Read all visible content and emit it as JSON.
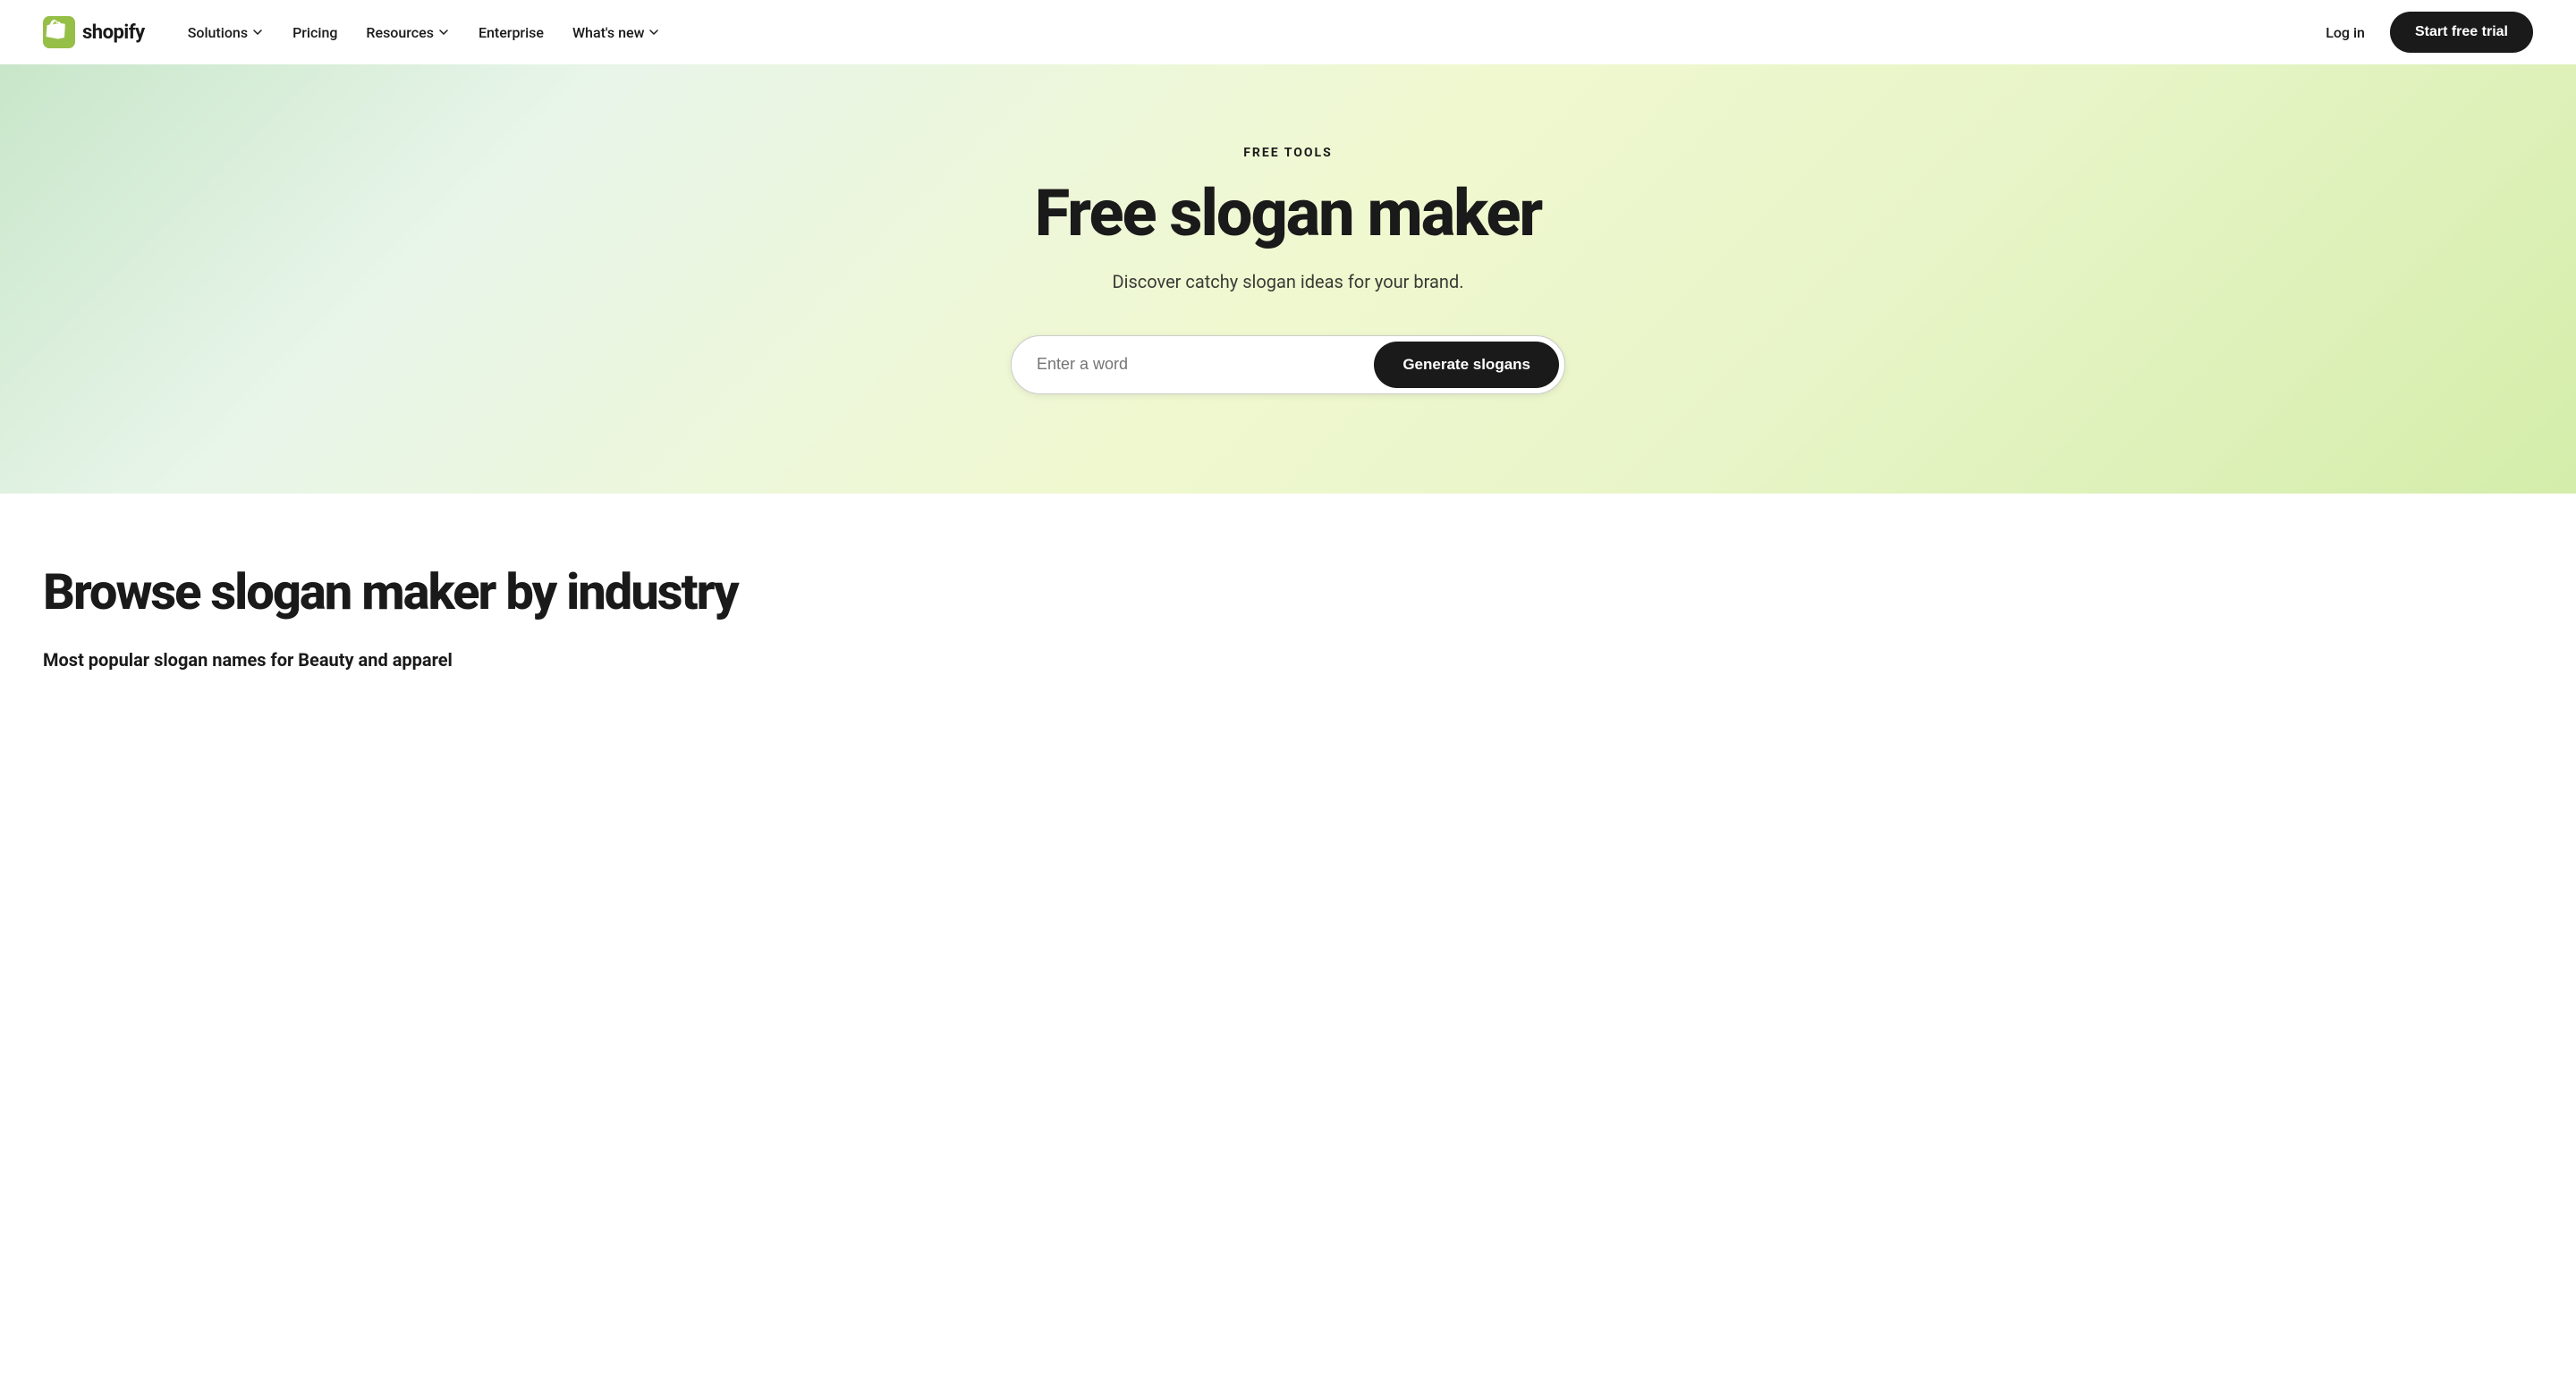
{
  "navbar": {
    "logo_text": "shopify",
    "nav_items": [
      {
        "label": "Solutions",
        "has_dropdown": true
      },
      {
        "label": "Pricing",
        "has_dropdown": false
      },
      {
        "label": "Resources",
        "has_dropdown": true
      },
      {
        "label": "Enterprise",
        "has_dropdown": false
      },
      {
        "label": "What's new",
        "has_dropdown": true
      }
    ],
    "login_label": "Log in",
    "trial_label": "Start free trial"
  },
  "hero": {
    "eyebrow": "FREE TOOLS",
    "title": "Free slogan maker",
    "subtitle": "Discover catchy slogan ideas for your brand.",
    "input_placeholder": "Enter a word",
    "generate_label": "Generate slogans"
  },
  "browse": {
    "title": "Browse slogan maker by industry",
    "subtitle": "Most popular slogan names for Beauty and apparel"
  }
}
